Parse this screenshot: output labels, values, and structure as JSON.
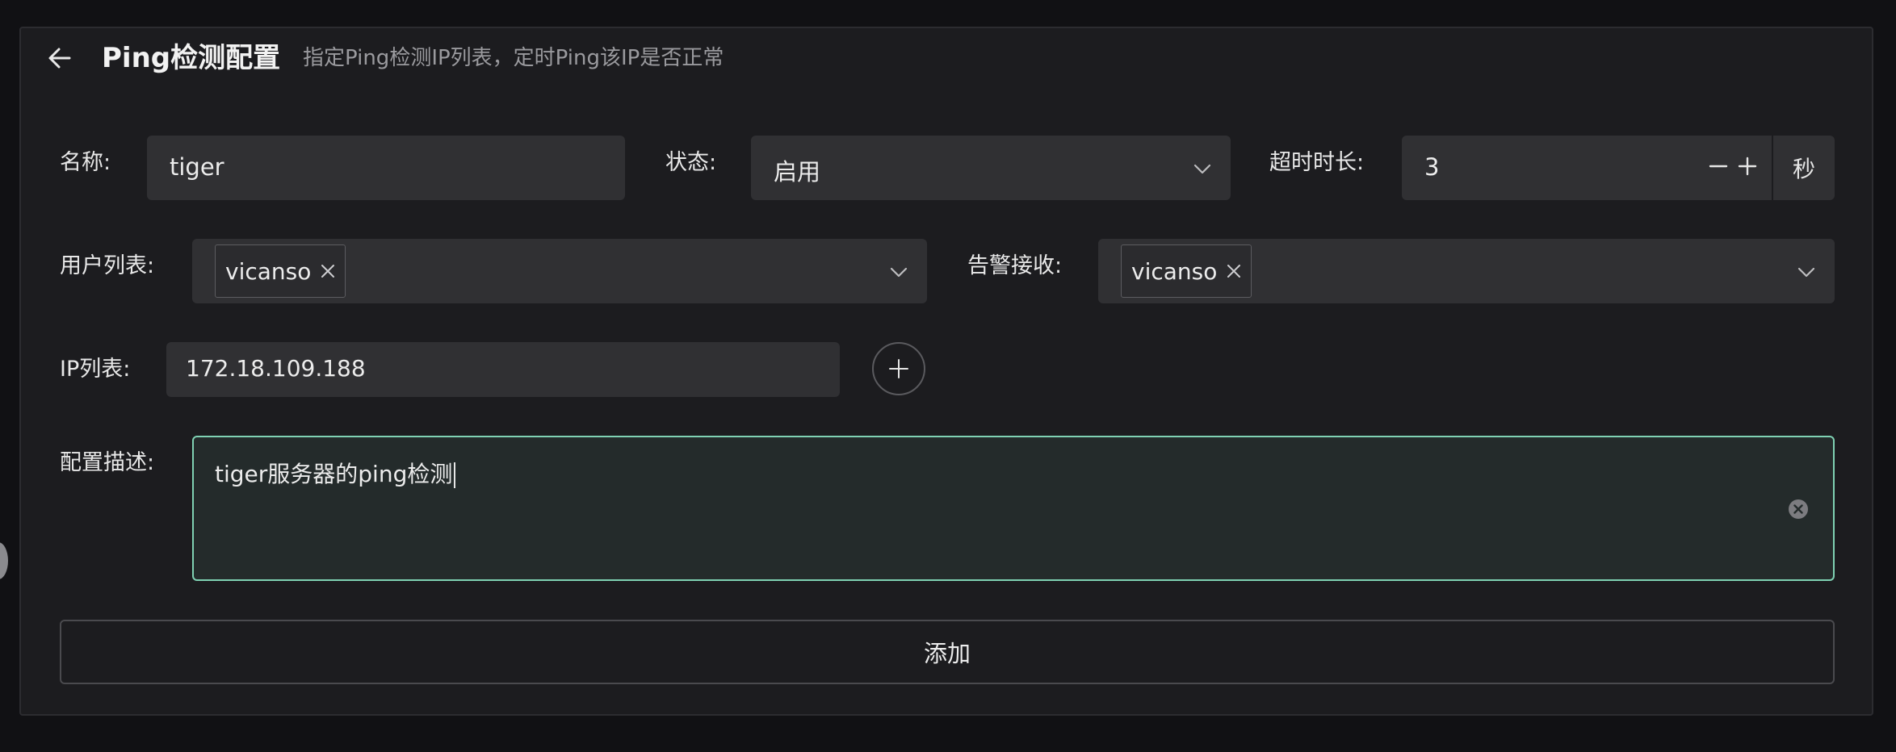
{
  "header": {
    "title": "Ping检测配置",
    "subtitle": "指定Ping检测IP列表，定时Ping该IP是否正常"
  },
  "form": {
    "name": {
      "label": "名称:",
      "value": "tiger"
    },
    "status": {
      "label": "状态:",
      "value": "启用"
    },
    "timeout": {
      "label": "超时时长:",
      "value": "3",
      "decrement": "−",
      "increment": "+",
      "unit": "秒"
    },
    "users": {
      "label": "用户列表:",
      "tags": [
        "vicanso"
      ]
    },
    "alert": {
      "label": "告警接收:",
      "tags": [
        "vicanso"
      ]
    },
    "ips": {
      "label": "IP列表:",
      "values": [
        "172.18.109.188"
      ]
    },
    "description": {
      "label": "配置描述:",
      "value": "tiger服务器的ping检测"
    },
    "submit_label": "添加"
  },
  "colors": {
    "background": "#111114",
    "card": "#1c1c1f",
    "field": "#303033",
    "focus_border": "#7fd1b3",
    "muted_text": "#9a9a9e"
  },
  "icons": {
    "back": "arrow-left-icon",
    "dropdown": "chevron-down-icon",
    "tag_close": "close-icon",
    "add": "plus-icon",
    "clear": "clear-circle-icon"
  }
}
